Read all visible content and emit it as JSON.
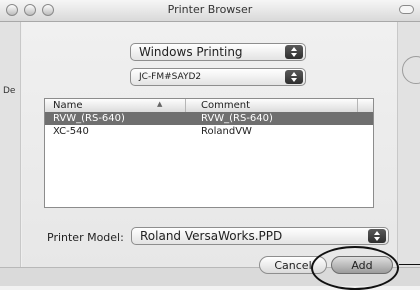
{
  "window": {
    "title": "Printer Browser"
  },
  "background": {
    "left_text": "De"
  },
  "connection_popup": {
    "value": "Windows Printing"
  },
  "server_popup": {
    "value": "JC-FM#SAYD2"
  },
  "printer_list": {
    "columns": [
      "Name",
      "Comment"
    ],
    "rows": [
      {
        "name": "RVW_(RS-640)",
        "comment": "RVW_(RS-640)",
        "selected": true
      },
      {
        "name": "XC-540",
        "comment": "RolandVW",
        "selected": false
      }
    ]
  },
  "printer_model": {
    "label": "Printer Model:",
    "value": "Roland VersaWorks.PPD"
  },
  "buttons": {
    "cancel": "Cancel",
    "add": "Add"
  },
  "icons": {
    "popup_arrows": "up-down-arrows-icon",
    "sort": "sort-ascending-icon"
  }
}
